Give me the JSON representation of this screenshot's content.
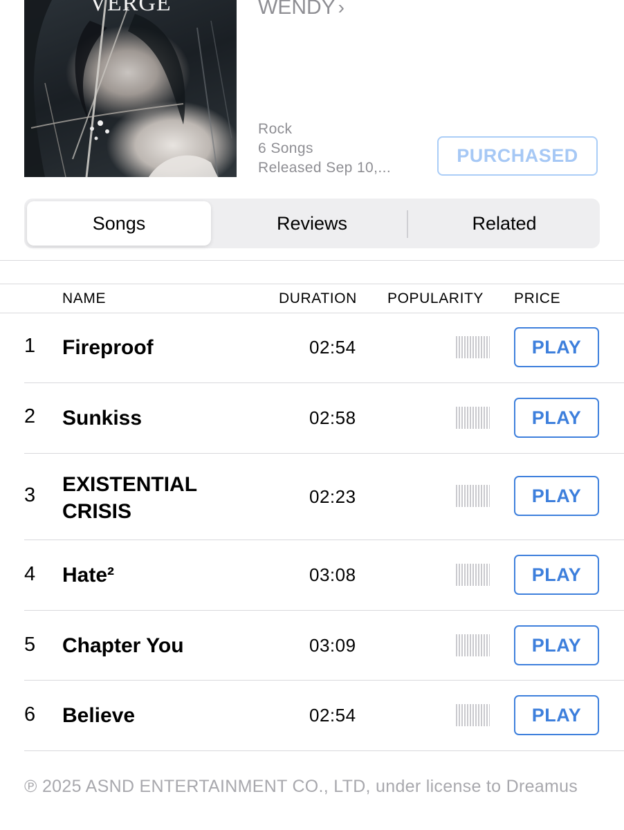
{
  "album": {
    "artwork_title": "VERGE",
    "artist": "WENDY",
    "artist_chevron": "›",
    "genre": "Rock",
    "song_count": "6 Songs",
    "released": "Released Sep 10,...",
    "purchase_state": "PURCHASED"
  },
  "tabs": [
    {
      "label": "Songs",
      "active": true
    },
    {
      "label": "Reviews",
      "active": false
    },
    {
      "label": "Related",
      "active": false
    }
  ],
  "table": {
    "columns": {
      "name": "NAME",
      "duration": "DURATION",
      "popularity": "POPULARITY",
      "price": "PRICE"
    },
    "rows": [
      {
        "num": "1",
        "name": "Fireproof",
        "duration": "02:54",
        "action": "PLAY"
      },
      {
        "num": "2",
        "name": "Sunkiss",
        "duration": "02:58",
        "action": "PLAY"
      },
      {
        "num": "3",
        "name": "EXISTENTIAL CRISIS",
        "duration": "02:23",
        "action": "PLAY"
      },
      {
        "num": "4",
        "name": "Hate²",
        "duration": "03:08",
        "action": "PLAY"
      },
      {
        "num": "5",
        "name": "Chapter You",
        "duration": "03:09",
        "action": "PLAY"
      },
      {
        "num": "6",
        "name": "Believe",
        "duration": "02:54",
        "action": "PLAY"
      }
    ]
  },
  "copyright": "℗ 2025 ASND ENTERTAINMENT CO., LTD, under license to Dreamus",
  "colors": {
    "accent": "#3d7fdc",
    "purchased": "#a6c8f5",
    "secondary_text": "#8e8e93"
  }
}
